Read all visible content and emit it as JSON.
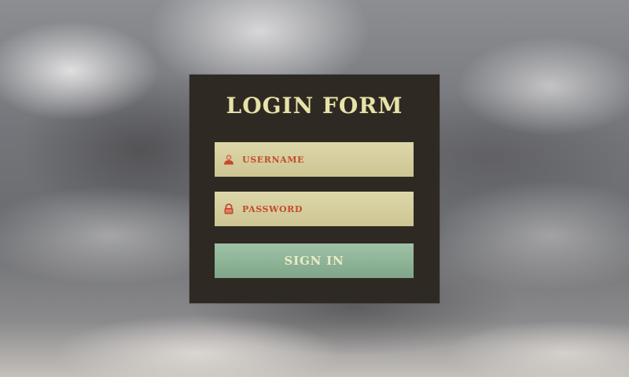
{
  "form": {
    "title": "LOGIN FORM",
    "username": {
      "placeholder": "USERNAME",
      "icon": "user-icon"
    },
    "password": {
      "placeholder": "PASSWORD",
      "icon": "lock-icon"
    },
    "submit_label": "SIGN IN"
  },
  "colors": {
    "panel": "#2e2a23",
    "title": "#e7e3a8",
    "field": "#d6cf9e",
    "field_label": "#c44a2b",
    "button": "#8eb397",
    "button_text": "#ecebc4"
  }
}
